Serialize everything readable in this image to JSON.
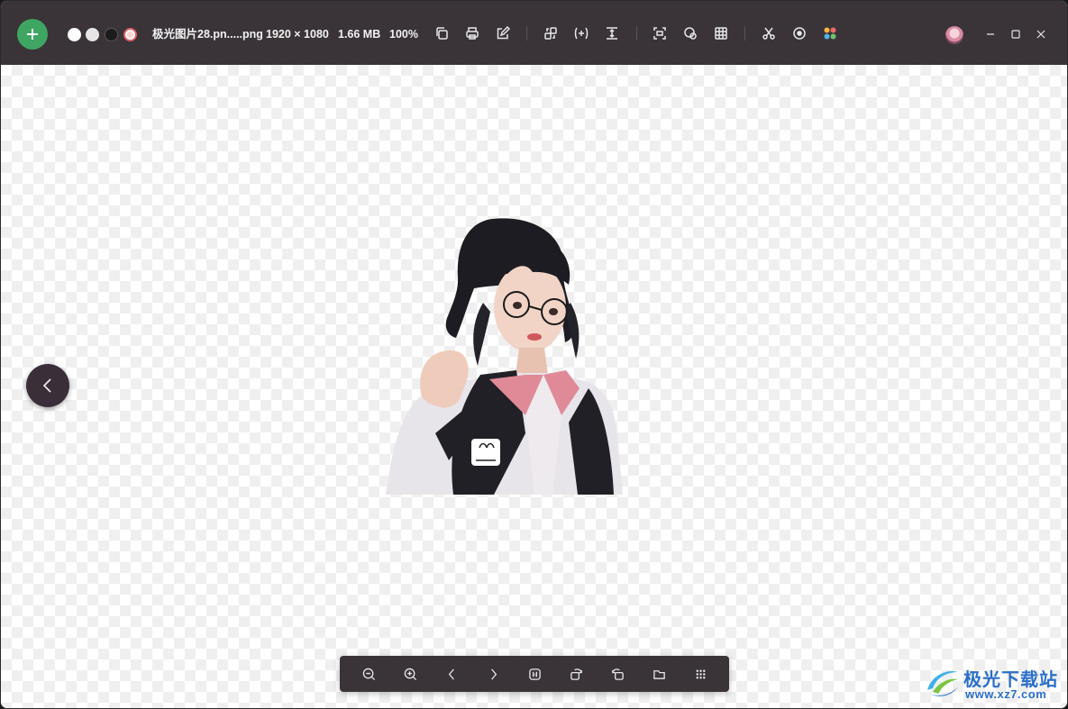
{
  "window": {
    "title": "极光图片28.pn.....png"
  },
  "toolbar": {
    "add_icon": "plus-icon",
    "background_swatches": [
      {
        "name": "white",
        "color": "#ffffff"
      },
      {
        "name": "light-gray",
        "color": "#e6e6e6"
      },
      {
        "name": "black",
        "color": "#1b1b1b"
      },
      {
        "name": "transparent",
        "color": "#e06060"
      }
    ],
    "filename": "极光图片28.pn.....png",
    "dimensions": "1920 × 1080",
    "filesize": "1.66 MB",
    "zoom": "100%",
    "tools": [
      "copy-icon",
      "print-icon",
      "edit-icon",
      "convert-icon",
      "compress-icon",
      "resize-icon",
      "ocr-scan-icon",
      "color-picker-icon",
      "grid-icon",
      "cut-icon",
      "record-icon",
      "apps-icon"
    ]
  },
  "window_controls": [
    "minimize-icon",
    "maximize-icon",
    "close-icon"
  ],
  "navigation": {
    "prev_icon": "chevron-left-icon"
  },
  "bottom_toolbar": {
    "tools": [
      "zoom-out-icon",
      "zoom-in-icon",
      "prev-image-icon",
      "next-image-icon",
      "actual-size-icon",
      "rotate-left-icon",
      "rotate-right-icon",
      "open-folder-icon",
      "more-icon"
    ]
  },
  "watermark": {
    "title": "极光下载站",
    "url": "www.xz7.com"
  },
  "colors": {
    "toolbar_bg": "#3a3438",
    "add_button": "#3fa562",
    "watermark_blue": "#2b6fc8"
  }
}
